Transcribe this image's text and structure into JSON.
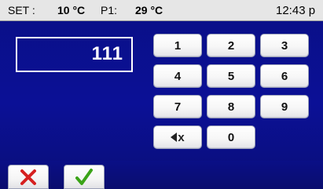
{
  "status_bar": {
    "set_label": "SET :",
    "set_value": "10 °C",
    "p1_label": "P1:",
    "p1_value": "29 °C",
    "time": "12:43 p"
  },
  "display": {
    "value": "111"
  },
  "keypad": {
    "keys": [
      "1",
      "2",
      "3",
      "4",
      "5",
      "6",
      "7",
      "8",
      "9",
      "0"
    ],
    "backspace_icon": "backspace-icon",
    "backspace_label": "x"
  },
  "actions": {
    "cancel_icon": "x-icon",
    "ok_icon": "checkmark-icon"
  },
  "colors": {
    "background": "#0a0f86",
    "statusbar": "#e6e6e6",
    "cancel": "#d62020",
    "ok": "#3aa317"
  }
}
